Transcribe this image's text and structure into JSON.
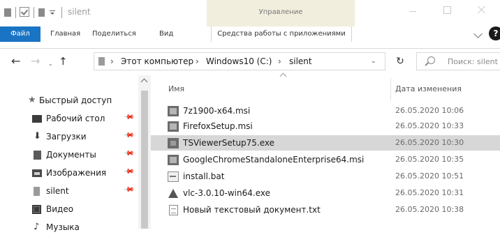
{
  "window": {
    "title": "silent",
    "context_tab_title": "Управление"
  },
  "ribbon": {
    "tabs": [
      {
        "label": "Файл"
      },
      {
        "label": "Главная"
      },
      {
        "label": "Поделиться"
      },
      {
        "label": "Вид"
      },
      {
        "label": "Средства работы с приложениями"
      }
    ],
    "help_label": "?"
  },
  "address": {
    "back": "←",
    "forward": "→",
    "recent": "⌄",
    "up": "↑",
    "separator": "›",
    "crumbs": [
      "Этот компьютер",
      "Windows10 (C:)",
      "silent"
    ],
    "dropdown": "⌄",
    "refresh": "↻",
    "search_placeholder": "Поиск: silent"
  },
  "sidebar": {
    "pin_glyph": "📌",
    "items": [
      {
        "label": "Быстрый доступ",
        "icon": "star-icon"
      },
      {
        "label": "Рабочий стол",
        "icon": "desktop-icon",
        "pinned": true
      },
      {
        "label": "Загрузки",
        "icon": "download-icon",
        "pinned": true
      },
      {
        "label": "Документы",
        "icon": "documents-icon",
        "pinned": true
      },
      {
        "label": "Изображения",
        "icon": "pictures-icon",
        "pinned": true
      },
      {
        "label": "silent",
        "icon": "folder-icon",
        "pinned": true
      },
      {
        "label": "Видео",
        "icon": "video-icon"
      },
      {
        "label": "Музыка",
        "icon": "music-icon"
      }
    ],
    "star_glyph": "★",
    "download_glyph": "⬇",
    "music_glyph": "♪"
  },
  "filelist": {
    "columns": {
      "name": "Имя",
      "date": "Дата изменения"
    },
    "files": [
      {
        "name": "7z1900-x64.msi",
        "date": "26.05.2020 10:06",
        "type": "msi"
      },
      {
        "name": "FirefoxSetup.msi",
        "date": "26.05.2020 10:33",
        "type": "msi"
      },
      {
        "name": "TSViewerSetup75.exe",
        "date": "26.05.2020 10:30",
        "type": "exe",
        "selected": true
      },
      {
        "name": "GoogleChromeStandaloneEnterprise64.msi",
        "date": "26.05.2020 10:35",
        "type": "msi"
      },
      {
        "name": "install.bat",
        "date": "26.05.2020 10:51",
        "type": "bat"
      },
      {
        "name": "vlc-3.0.10-win64.exe",
        "date": "26.05.2020 10:31",
        "type": "vlc"
      },
      {
        "name": "Новый текстовый документ.txt",
        "date": "26.05.2020 10:38",
        "type": "txt"
      }
    ]
  },
  "colors": {
    "file_tab": "#1a74c4",
    "context_tab": "#f1eedd",
    "selection": "#d7d7d7"
  }
}
